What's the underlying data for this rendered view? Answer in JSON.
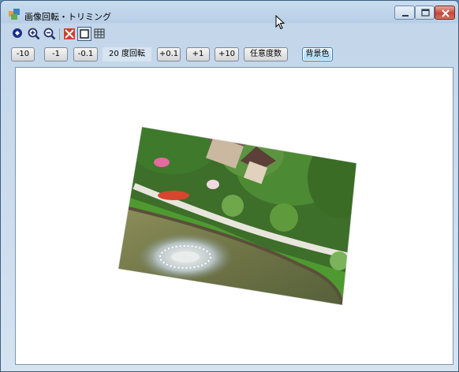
{
  "window": {
    "title": "画像回転・トリミング"
  },
  "toolbar": {
    "icons": [
      "fit-icon",
      "zoom-in-icon",
      "zoom-out-icon",
      "crop-icon",
      "frame-icon",
      "grid-icon"
    ]
  },
  "rotation_buttons": {
    "minus10": "-10",
    "minus1": "-1",
    "minus01": "-0.1",
    "degree_readout": "20 度回転",
    "plus01": "+0.1",
    "plus1": "+1",
    "plus10": "+10",
    "arbitrary": "任意度数",
    "background_color": "背景色"
  },
  "image": {
    "rotation_degrees": 20,
    "subject": "garden-with-fountain-and-house"
  },
  "colors": {
    "title_bar": "#c9dcef",
    "close_button": "#c6463a",
    "canvas_background": "#ffffff"
  }
}
